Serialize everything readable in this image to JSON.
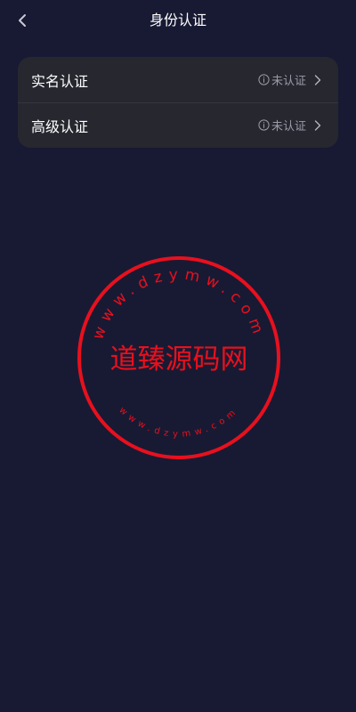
{
  "header": {
    "title": "身份认证",
    "back_icon": "chevron-left-icon"
  },
  "verification_items": [
    {
      "label": "实名认证",
      "status": "未认证",
      "status_icon": "info-icon",
      "arrow_icon": "chevron-right-icon"
    },
    {
      "label": "高级认证",
      "status": "未认证",
      "status_icon": "info-icon",
      "arrow_icon": "chevron-right-icon"
    }
  ],
  "watermark": {
    "center_text": "道臻源码网",
    "top_text": "www.dzymw.com",
    "bottom_text": "www.dzymw.com",
    "color": "#e8101e"
  },
  "colors": {
    "background": "#181a33",
    "card": "#26272f",
    "status_text": "#9a9ba6"
  }
}
